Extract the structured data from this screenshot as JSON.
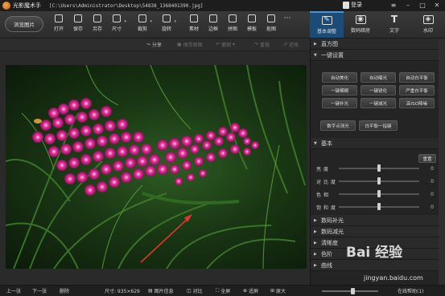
{
  "app": {
    "name": "光影魔术手",
    "file_path": "[C:\\Users\\Administrator\\Desktop\\54838_1368401390.jpg]",
    "login_label": "登录"
  },
  "toolbar": {
    "browse_label": "浏览图片",
    "tools": [
      {
        "label": "打开",
        "icon": "open-folder-icon"
      },
      {
        "label": "保存",
        "icon": "save-icon"
      },
      {
        "label": "另存",
        "icon": "save-as-icon"
      },
      {
        "label": "尺寸",
        "icon": "resize-icon"
      },
      {
        "label": "裁剪",
        "icon": "crop-icon"
      },
      {
        "label": "旋转",
        "icon": "rotate-icon"
      },
      {
        "label": "素材",
        "icon": "material-icon"
      },
      {
        "label": "边框",
        "icon": "border-icon"
      },
      {
        "label": "拼图",
        "icon": "collage-icon"
      },
      {
        "label": "模板",
        "icon": "template-icon"
      },
      {
        "label": "抠图",
        "icon": "cutout-icon"
      }
    ],
    "more_label": "···"
  },
  "right_tabs": [
    {
      "label": "基本调整",
      "icon": "adjust-icon",
      "active": true
    },
    {
      "label": "数码暗房",
      "icon": "camera-icon",
      "active": false
    },
    {
      "label": "文字",
      "icon": "text-icon",
      "active": false
    },
    {
      "label": "水印",
      "icon": "watermark-icon",
      "active": false
    }
  ],
  "subbar": {
    "share": "分享",
    "save_as_original": "保存原图",
    "undo": "撤销",
    "redo": "重做",
    "reset": "还原"
  },
  "panel": {
    "histogram": "直方图",
    "one_click": "一键设置",
    "buttons": [
      [
        "自动美化",
        "自动曝光",
        "自动白平衡"
      ],
      [
        "一键模糊",
        "一键锐化",
        "严重白平衡"
      ],
      [
        "一键补光",
        "一键减光",
        "高ISO降噪"
      ]
    ],
    "digital_fill": "数字点测光",
    "white_balance": "白平衡一指键",
    "basic": "基本",
    "reset": "重置",
    "sliders": [
      {
        "label": "亮度",
        "value": "0",
        "level": 0.5
      },
      {
        "label": "对比度",
        "value": "0",
        "level": 0.5
      },
      {
        "label": "色相",
        "value": "0",
        "level": 0.5
      },
      {
        "label": "饱和度",
        "value": "0",
        "level": 0.5
      }
    ],
    "sections": [
      "数码补光",
      "数码减光",
      "清晰度",
      "色阶",
      "曲线"
    ]
  },
  "status": {
    "prev": "上一张",
    "next": "下一张",
    "delete": "删除",
    "size": "尺寸: 935×629",
    "info": "图片信息",
    "compare": "对比",
    "fullscreen": "全屏",
    "fit": "适屏",
    "original": "原大",
    "feedback": "在线帮助(1)"
  },
  "watermark": {
    "brand": "Bai 经验",
    "url": "jingyan.baidu.com"
  },
  "colors": {
    "accent": "#1b4c77",
    "flower_pink": "#d61f8f",
    "arrow_red": "#d63a2a"
  }
}
